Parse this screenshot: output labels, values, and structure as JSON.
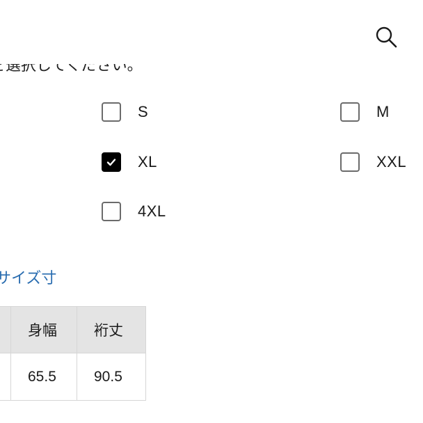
{
  "header": {
    "search_icon": "search-icon"
  },
  "instruction_text": "を選択してください。",
  "size_options": [
    {
      "label": "S",
      "checked": false
    },
    {
      "label": "M",
      "checked": false
    },
    {
      "label": "XL",
      "checked": true
    },
    {
      "label": "XXL",
      "checked": false
    },
    {
      "label": "4XL",
      "checked": false
    }
  ],
  "size_chart_link": "サイズ寸",
  "size_table": {
    "headers": [
      "",
      "身幅",
      "裄丈"
    ],
    "rows": [
      [
        "",
        "65.5",
        "90.5"
      ]
    ]
  },
  "colors": {
    "link": "#2a6db0",
    "header_bg": "#e4e4e4",
    "checked_bg": "#000000"
  }
}
